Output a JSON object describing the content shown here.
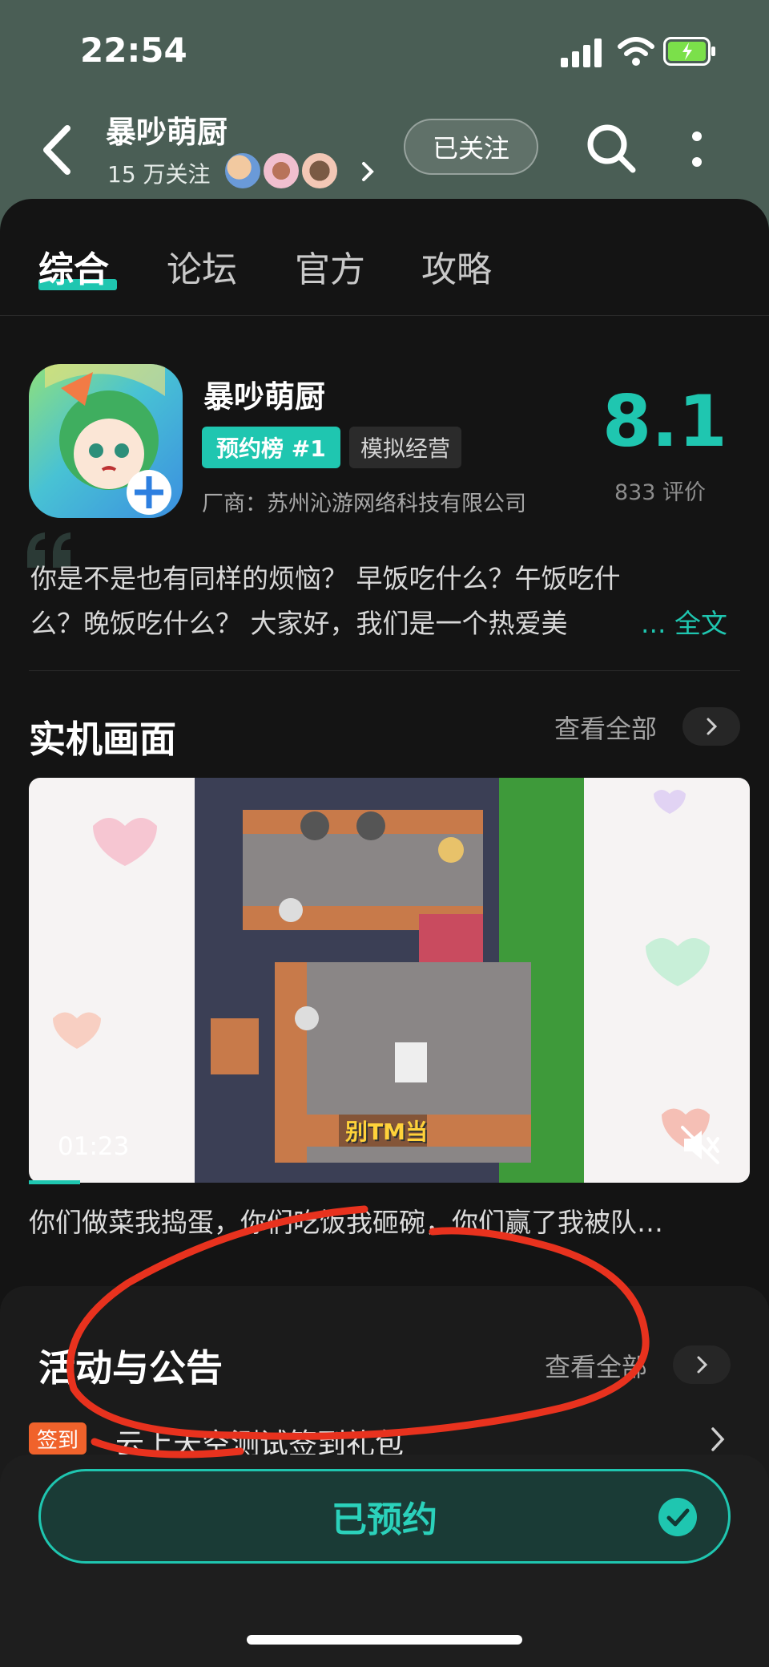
{
  "status_bar": {
    "time": "22:54"
  },
  "header": {
    "title": "暴吵萌厨",
    "follower_count": "15 万关注",
    "follow_button_label": "已关注"
  },
  "tabs": [
    "综合",
    "论坛",
    "官方",
    "攻略"
  ],
  "game": {
    "name": "暴吵萌厨",
    "rank_badge": "预约榜 #1",
    "genre_tag": "模拟经营",
    "developer": "厂商：苏州沁游网络科技有限公司",
    "rating": "8.1",
    "rating_count": "833 评价",
    "description_line1": "你是不是也有同样的烦恼？  早饭吃什么？午饭吃什",
    "description_line2": "么？晚饭吃什么？  大家好，我们是一个热爱美",
    "description_more": "... 全文"
  },
  "screenshots_section": {
    "title": "实机画面",
    "see_all": "查看全部",
    "video_duration": "01:23",
    "video_overlay_text": "别TM当",
    "video_caption": "你们做菜我捣蛋，你们吃饭我砸碗，你们赢了我被队…"
  },
  "activity_section": {
    "title": "活动与公告",
    "see_all": "查看全部",
    "item_badge": "签到",
    "item_title": "云上天空测试签到礼包"
  },
  "bottom_bar": {
    "reserve_label": "已预约"
  },
  "colors": {
    "accent": "#1fc6b0",
    "header_bg": "#4a5e55",
    "card_bg": "#141414",
    "badge_orange": "#f0622b"
  }
}
